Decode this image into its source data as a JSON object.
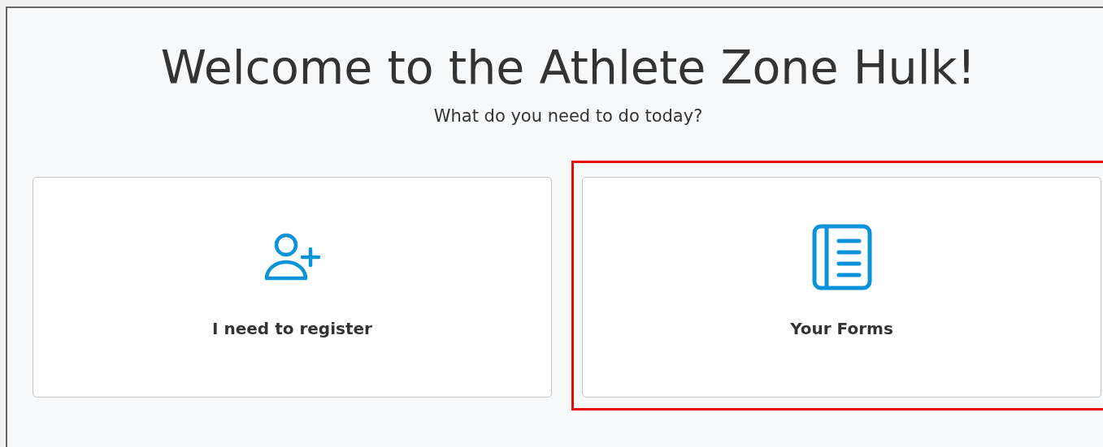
{
  "title": "Welcome to the Athlete Zone Hulk!",
  "subtitle": "What do you need to do today?",
  "cards": [
    {
      "kind": "register",
      "label": "I need to register",
      "highlighted": false
    },
    {
      "kind": "forms",
      "label": "Your Forms",
      "highlighted": true
    }
  ]
}
